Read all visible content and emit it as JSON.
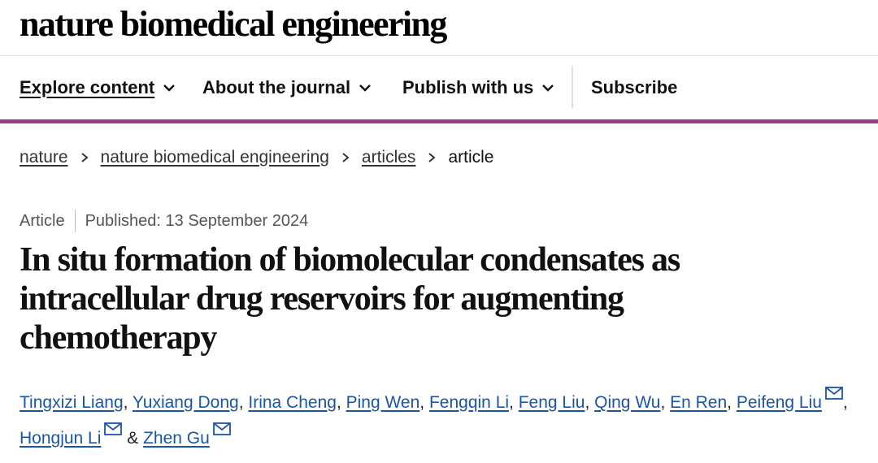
{
  "site": {
    "logo": "nature biomedical engineering"
  },
  "nav": {
    "items": [
      {
        "label": "Explore content"
      },
      {
        "label": "About the journal"
      },
      {
        "label": "Publish with us"
      },
      {
        "label": "Subscribe"
      }
    ]
  },
  "breadcrumb": [
    {
      "label": "nature"
    },
    {
      "label": "nature biomedical engineering"
    },
    {
      "label": "articles"
    },
    {
      "label": "article"
    }
  ],
  "article": {
    "type": "Article",
    "published": "Published: 13 September 2024",
    "title_lines": [
      "In situ formation of biomolecular condensates as",
      "intracellular drug reservoirs for augmenting",
      "chemotherapy"
    ],
    "authors": [
      "Tingxizi Liang",
      "Yuxiang Dong",
      "Irina Cheng",
      "Ping Wen",
      "Fengqin Li",
      "Feng Liu",
      "Qing Wu",
      "En Ren",
      "Peifeng Liu",
      "Hongjun Li",
      "Zhen Gu"
    ],
    "separators": {
      "comma": ", ",
      "ampersand": " & "
    }
  },
  "colors": {
    "accent_bar": "#9b3b8f",
    "author_link": "#1a55a8"
  }
}
